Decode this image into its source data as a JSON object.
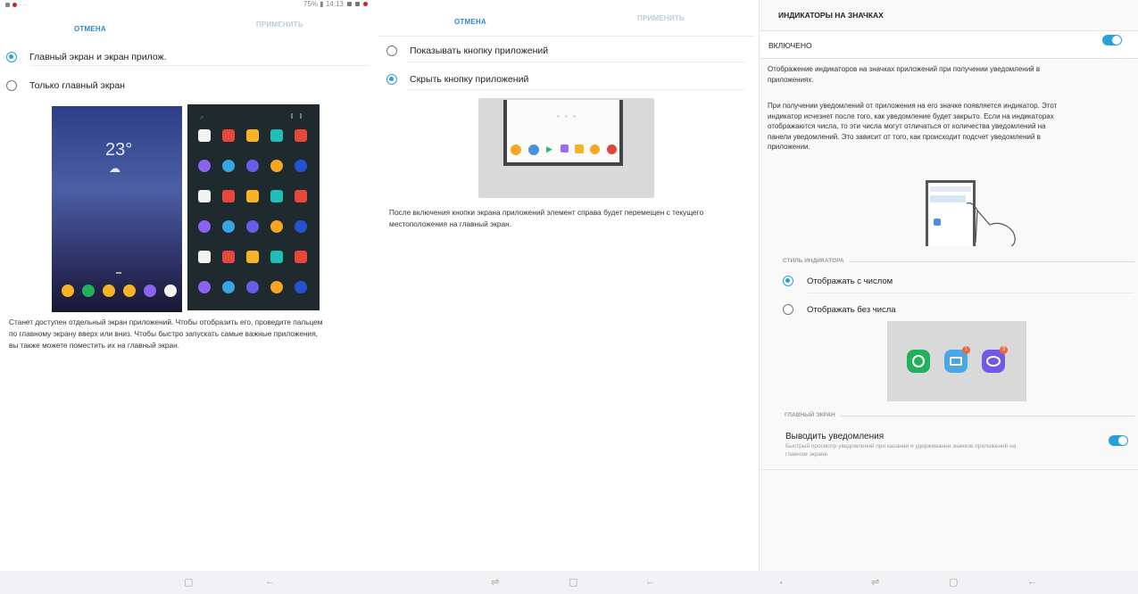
{
  "status_bar": {
    "clock": "75% ▮ 14:13"
  },
  "panel1": {
    "cancel": "ОТМЕНА",
    "apply": "ПРИМЕНИТЬ",
    "options": [
      {
        "label": "Главный экран и экран прилож.",
        "selected": true
      },
      {
        "label": "Только главный экран",
        "selected": false
      }
    ],
    "preview": {
      "temperature": "23°",
      "weather_icon": "cloudy-icon"
    },
    "description_lines": [
      "Станет доступен отдельный экран приложений. Чтобы отобразить его, проведите пальцем",
      "по главному экрану вверх или вниз. Чтобы быстро запускать самые важные приложения,",
      "вы также можете поместить их на главный экран."
    ]
  },
  "panel2": {
    "cancel": "ОТМЕНА",
    "apply": "ПРИМЕНИТЬ",
    "options": [
      {
        "label": "Показывать кнопку приложений",
        "selected": false
      },
      {
        "label": "Скрыть кнопку приложений",
        "selected": true
      }
    ],
    "description_lines": [
      "После включения кнопки экрана приложений элемент справа будет перемещен с текущего",
      "местоположения на главный экран."
    ]
  },
  "panel3": {
    "title": "ИНДИКАТОРЫ НА ЗНАЧКАХ",
    "enabled_label": "ВКЛЮЧЕНО",
    "enabled": true,
    "intro_lines": [
      "Отображение индикаторов на значках приложений при получении уведомлений в",
      "приложениях."
    ],
    "details_lines": [
      "При получении уведомлений от приложения на его значке появляется индикатор. Этот",
      "индикатор исчезнет после того, как уведомление будет закрыто. Если на индикаторах",
      "отображаются числа, то эти числа могут отличаться от количества уведомлений на",
      "панели уведомлений. Это зависит от того, как происходит подсчет уведомлений в",
      "приложении."
    ],
    "style_section_label": "СТИЛЬ ИНДИКАТОРА",
    "style_options": [
      {
        "label": "Отображать с числом",
        "selected": true
      },
      {
        "label": "Отображать без числа",
        "selected": false
      }
    ],
    "badge_counts": [
      "1",
      "3"
    ],
    "home_section_label": "ГЛАВНЫЙ ЭКРАН",
    "notif_title": "Выводить уведомления",
    "notif_desc_lines": [
      "Быстрый просмотр уведомлений при касании и удерживании значков приложений на",
      "главном экране."
    ],
    "notif_enabled": true
  },
  "colors": {
    "accent": "#2aa0d8",
    "cancel": "#2f86c9",
    "apply_disabled": "#b8cde0"
  }
}
